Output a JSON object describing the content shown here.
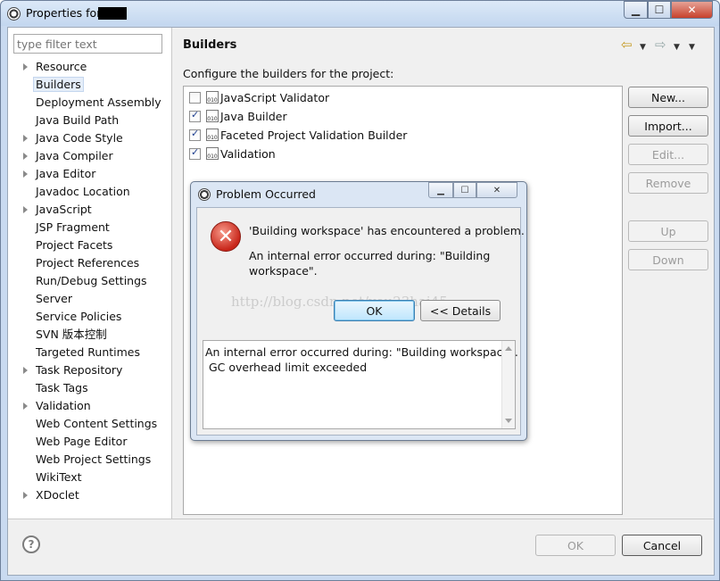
{
  "window": {
    "title": "Properties for"
  },
  "filter": {
    "placeholder": "type filter text"
  },
  "tree": {
    "items": [
      {
        "label": "Resource",
        "expandable": true
      },
      {
        "label": "Builders",
        "expandable": false,
        "selected": true
      },
      {
        "label": "Deployment Assembly",
        "expandable": false
      },
      {
        "label": "Java Build Path",
        "expandable": false
      },
      {
        "label": "Java Code Style",
        "expandable": true
      },
      {
        "label": "Java Compiler",
        "expandable": true
      },
      {
        "label": "Java Editor",
        "expandable": true
      },
      {
        "label": "Javadoc Location",
        "expandable": false
      },
      {
        "label": "JavaScript",
        "expandable": true
      },
      {
        "label": "JSP Fragment",
        "expandable": false
      },
      {
        "label": "Project Facets",
        "expandable": false
      },
      {
        "label": "Project References",
        "expandable": false
      },
      {
        "label": "Run/Debug Settings",
        "expandable": false
      },
      {
        "label": "Server",
        "expandable": false
      },
      {
        "label": "Service Policies",
        "expandable": false
      },
      {
        "label": "SVN 版本控制",
        "expandable": false
      },
      {
        "label": "Targeted Runtimes",
        "expandable": false
      },
      {
        "label": "Task Repository",
        "expandable": true
      },
      {
        "label": "Task Tags",
        "expandable": false
      },
      {
        "label": "Validation",
        "expandable": true
      },
      {
        "label": "Web Content Settings",
        "expandable": false
      },
      {
        "label": "Web Page Editor",
        "expandable": false
      },
      {
        "label": "Web Project Settings",
        "expandable": false
      },
      {
        "label": "WikiText",
        "expandable": false
      },
      {
        "label": "XDoclet",
        "expandable": true
      }
    ]
  },
  "page": {
    "title": "Builders",
    "config_label": "Configure the builders for the project:",
    "builders": [
      {
        "label": "JavaScript Validator",
        "checked": false
      },
      {
        "label": "Java Builder",
        "checked": true
      },
      {
        "label": "Faceted Project Validation Builder",
        "checked": true
      },
      {
        "label": "Validation",
        "checked": true
      }
    ],
    "buttons": {
      "new": "New...",
      "import": "Import...",
      "edit": "Edit...",
      "remove": "Remove",
      "up": "Up",
      "down": "Down"
    }
  },
  "footer": {
    "ok": "OK",
    "cancel": "Cancel"
  },
  "dialog": {
    "title": "Problem Occurred",
    "message": "'Building workspace' has encountered a problem.",
    "detail": "An internal error occurred during: \"Building workspace\".",
    "ok": "OK",
    "details_button": "<< Details",
    "details_text": "An internal error occurred during: \"Building workspace\".\n GC overhead limit exceeded",
    "watermark": "http://blog.csdn.net/you23hai45"
  },
  "icon_binary_label": "010"
}
